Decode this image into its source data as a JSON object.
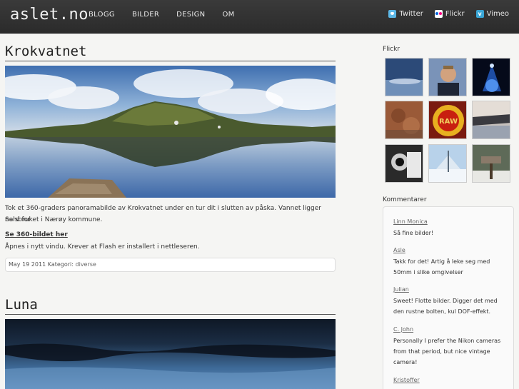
{
  "header": {
    "logo": "aslet.no",
    "nav": [
      "BLOGG",
      "BILDER",
      "DESIGN",
      "OM"
    ],
    "social": [
      {
        "label": "Twitter",
        "icon": "twitter-icon"
      },
      {
        "label": "Flickr",
        "icon": "flickr-icon"
      },
      {
        "label": "Vimeo",
        "icon": "vimeo-icon"
      }
    ]
  },
  "posts": [
    {
      "title": "Krokvatnet",
      "body_line1": "Tok et 360-graders panoramabilde av Krokvatnet under en tur dit i slutten av påska. Vannet ligger nord for",
      "body_line2": "Salsbruket i Nærøy kommune.",
      "link": "Se 360-bildet her",
      "note": "Åpnes i nytt vindu. Krever at Flash er installert i nettleseren.",
      "date": "May 19 2011",
      "category_label": "Kategori:",
      "category": "diverse"
    },
    {
      "title": "Luna"
    }
  ],
  "sidebar": {
    "flickr_heading": "Flickr",
    "comments_heading": "Kommentarer",
    "comments": [
      {
        "name": "Linn Monica",
        "lines": [
          "Så fine bilder!"
        ]
      },
      {
        "name": "Asle",
        "lines": [
          "Takk for det! Artig å leke seg med",
          "50mm i slike omgivelser"
        ]
      },
      {
        "name": "Julian",
        "lines": [
          "Sweet! Flotte bilder. Digger det med",
          "den rustne bolten, kul DOF-effekt."
        ]
      },
      {
        "name": "C. John",
        "lines": [
          "Personally I prefer the Nikon cameras",
          "from that period, but nice vintage",
          "camera!"
        ]
      },
      {
        "name": "Kristoffer",
        "lines": []
      }
    ]
  }
}
